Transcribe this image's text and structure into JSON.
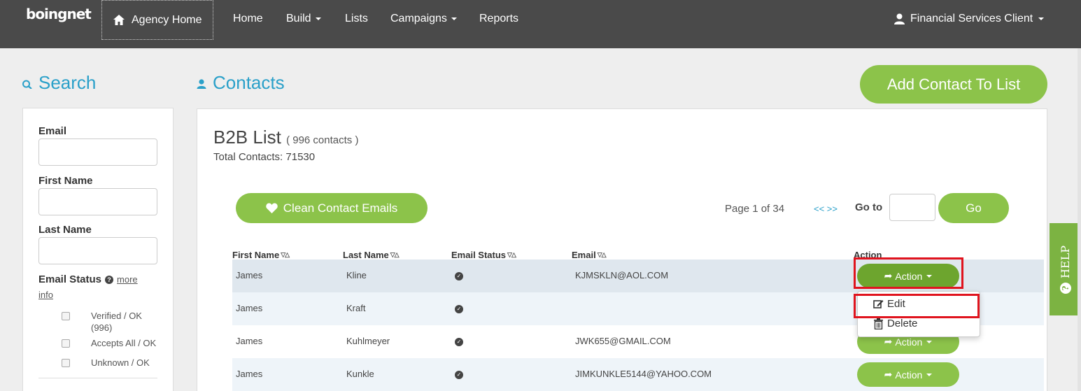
{
  "brand": {
    "logo_text": "boingnet"
  },
  "nav": {
    "agency_home": "Agency Home",
    "items": [
      {
        "label": "Home",
        "has_caret": false
      },
      {
        "label": "Build",
        "has_caret": true
      },
      {
        "label": "Lists",
        "has_caret": false
      },
      {
        "label": "Campaigns",
        "has_caret": true
      },
      {
        "label": "Reports",
        "has_caret": false
      }
    ],
    "user": "Financial Services Client"
  },
  "search": {
    "title": "Search",
    "email_label": "Email",
    "first_name_label": "First Name",
    "last_name_label": "Last Name",
    "email_status_label": "Email Status",
    "more_info": "more",
    "more_info_2": "info",
    "statuses": [
      {
        "label": "Verified / OK",
        "sub": "(996)"
      },
      {
        "label": "Accepts All / OK",
        "sub": ""
      },
      {
        "label": "Unknown / OK",
        "sub": ""
      }
    ]
  },
  "contacts": {
    "title": "Contacts",
    "add_button": "Add Contact To List",
    "list_name": "B2B List",
    "list_count": "( 996 contacts )",
    "total": "Total Contacts: 71530",
    "clean_button": "Clean Contact Emails",
    "page_info": "Page 1 of 34",
    "pager": "<< >>",
    "goto_label": "Go to",
    "go_button": "Go"
  },
  "table": {
    "headers": [
      "First Name",
      "Last Name",
      "Email Status",
      "Email",
      "Action"
    ],
    "sort_glyph": "▽△",
    "action_label": "Action",
    "rows": [
      {
        "first": "James",
        "last": "Kline",
        "email": "KJMSKLN@AOL.COM"
      },
      {
        "first": "James",
        "last": "Kraft",
        "email": ""
      },
      {
        "first": "James",
        "last": "Kuhlmeyer",
        "email": "JWK655@GMAIL.COM"
      },
      {
        "first": "James",
        "last": "Kunkle",
        "email": "JIMKUNKLE5144@YAHOO.COM"
      }
    ]
  },
  "dropdown": {
    "edit": "Edit",
    "delete": "Delete"
  },
  "help": {
    "label": "HELP"
  },
  "colors": {
    "accent_green": "#8cc34a",
    "title_blue": "#2aa0c9",
    "nav_bg": "#4a4a4a",
    "highlight_red": "#e0141e"
  }
}
